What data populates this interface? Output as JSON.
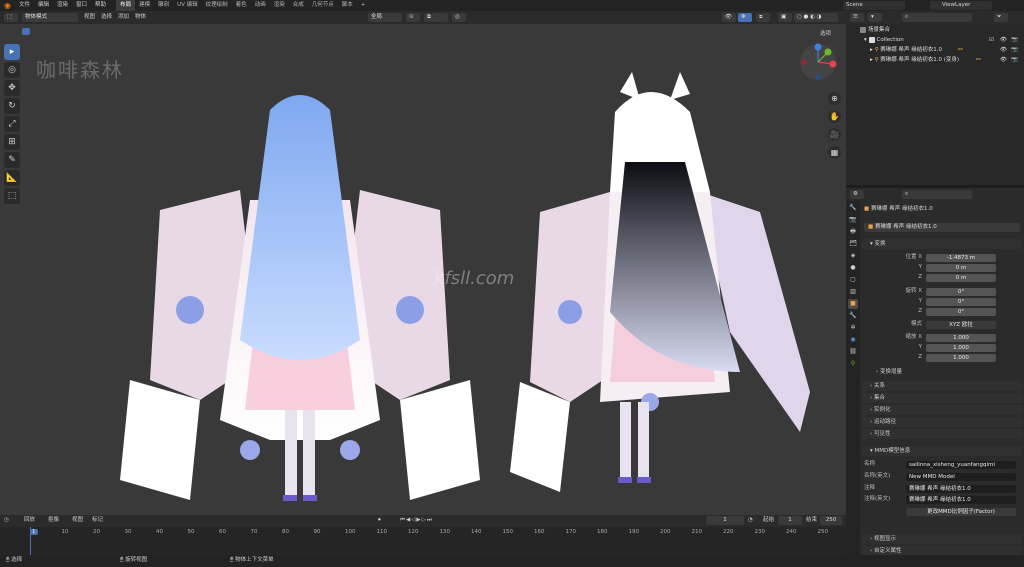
{
  "topbar": {
    "menus": [
      "文件",
      "编辑",
      "渲染",
      "窗口",
      "帮助"
    ],
    "workspaces": [
      "布局",
      "建模",
      "雕刻",
      "UV 编辑",
      "纹理绘制",
      "着色",
      "动画",
      "渲染",
      "合成",
      "几何节点",
      "脚本"
    ],
    "active_workspace": "布局",
    "scene": "Scene",
    "view_layer": "ViewLayer"
  },
  "viewport_header": {
    "mode": "物体模式",
    "menus": [
      "视图",
      "选择",
      "添加",
      "物体"
    ],
    "orientation": "全局",
    "options_label": "选项"
  },
  "viewport": {
    "watermark_top": "咖啡森林",
    "watermark_center": "kfsll.com",
    "gizmo_axes": [
      "X",
      "Y",
      "Z"
    ],
    "tools": [
      "select-box",
      "cursor",
      "move",
      "rotate",
      "scale",
      "transform",
      "annotate",
      "measure",
      "add-cube"
    ]
  },
  "timeline": {
    "menus": [
      "回放",
      "抠像",
      "视图",
      "标记"
    ],
    "current_frame": "1",
    "start_label": "起始",
    "start": "1",
    "end_label": "结束",
    "end": "250",
    "ruler": [
      "1",
      "10",
      "20",
      "30",
      "40",
      "50",
      "60",
      "70",
      "80",
      "90",
      "100",
      "110",
      "120",
      "130",
      "140",
      "150",
      "160",
      "170",
      "180",
      "190",
      "200",
      "210",
      "220",
      "230",
      "240",
      "250"
    ]
  },
  "statusbar": {
    "items": [
      "选择",
      "旋转视图",
      "物体上下文菜单"
    ]
  },
  "outliner": {
    "root": "场景集合",
    "collection": "Collection",
    "items": [
      "赛琳娜 希声 缘结初衣1.0",
      "赛琳娜 希声 缘结初衣1.0 (变身)"
    ]
  },
  "properties": {
    "object_path": "赛琳娜 希声 缘结初衣1.0",
    "object_name": "赛琳娜 希声 缘结初衣1.0",
    "transform_label": "变换",
    "location_label": "位置 X",
    "location": [
      "-1.4873 m",
      "0 m",
      "0 m"
    ],
    "rotation_label": "旋转 X",
    "rotation": [
      "0°",
      "0°",
      "0°"
    ],
    "mode_label": "模式",
    "mode_value": "XYZ 欧拉",
    "scale_label": "缩放 X",
    "scale": [
      "1.000",
      "1.000",
      "1.000"
    ],
    "delta_label": "变换增量",
    "axis_y": "Y",
    "axis_z": "Z",
    "sections": [
      "关系",
      "集合",
      "实例化",
      "运动路径",
      "可见性"
    ],
    "mmd_header": "MMD模型信息",
    "mmd_name_label": "名称",
    "mmd_name": "sailinna_xisheng_yuanfangqimi",
    "mmd_en_label": "名称(英文)",
    "mmd_en": "New MMD Model",
    "mmd_root_label": "注释",
    "mmd_root": "赛琳娜 希声 缘结初衣1.0",
    "mmd_root2_label": "注释(英文)",
    "mmd_root2": "赛琳娜 希声 缘结初衣1.0",
    "mmd_factor": "更改MMD比例因子(Factor)",
    "bottom_sections": [
      "视图显示",
      "自定义属性"
    ]
  }
}
